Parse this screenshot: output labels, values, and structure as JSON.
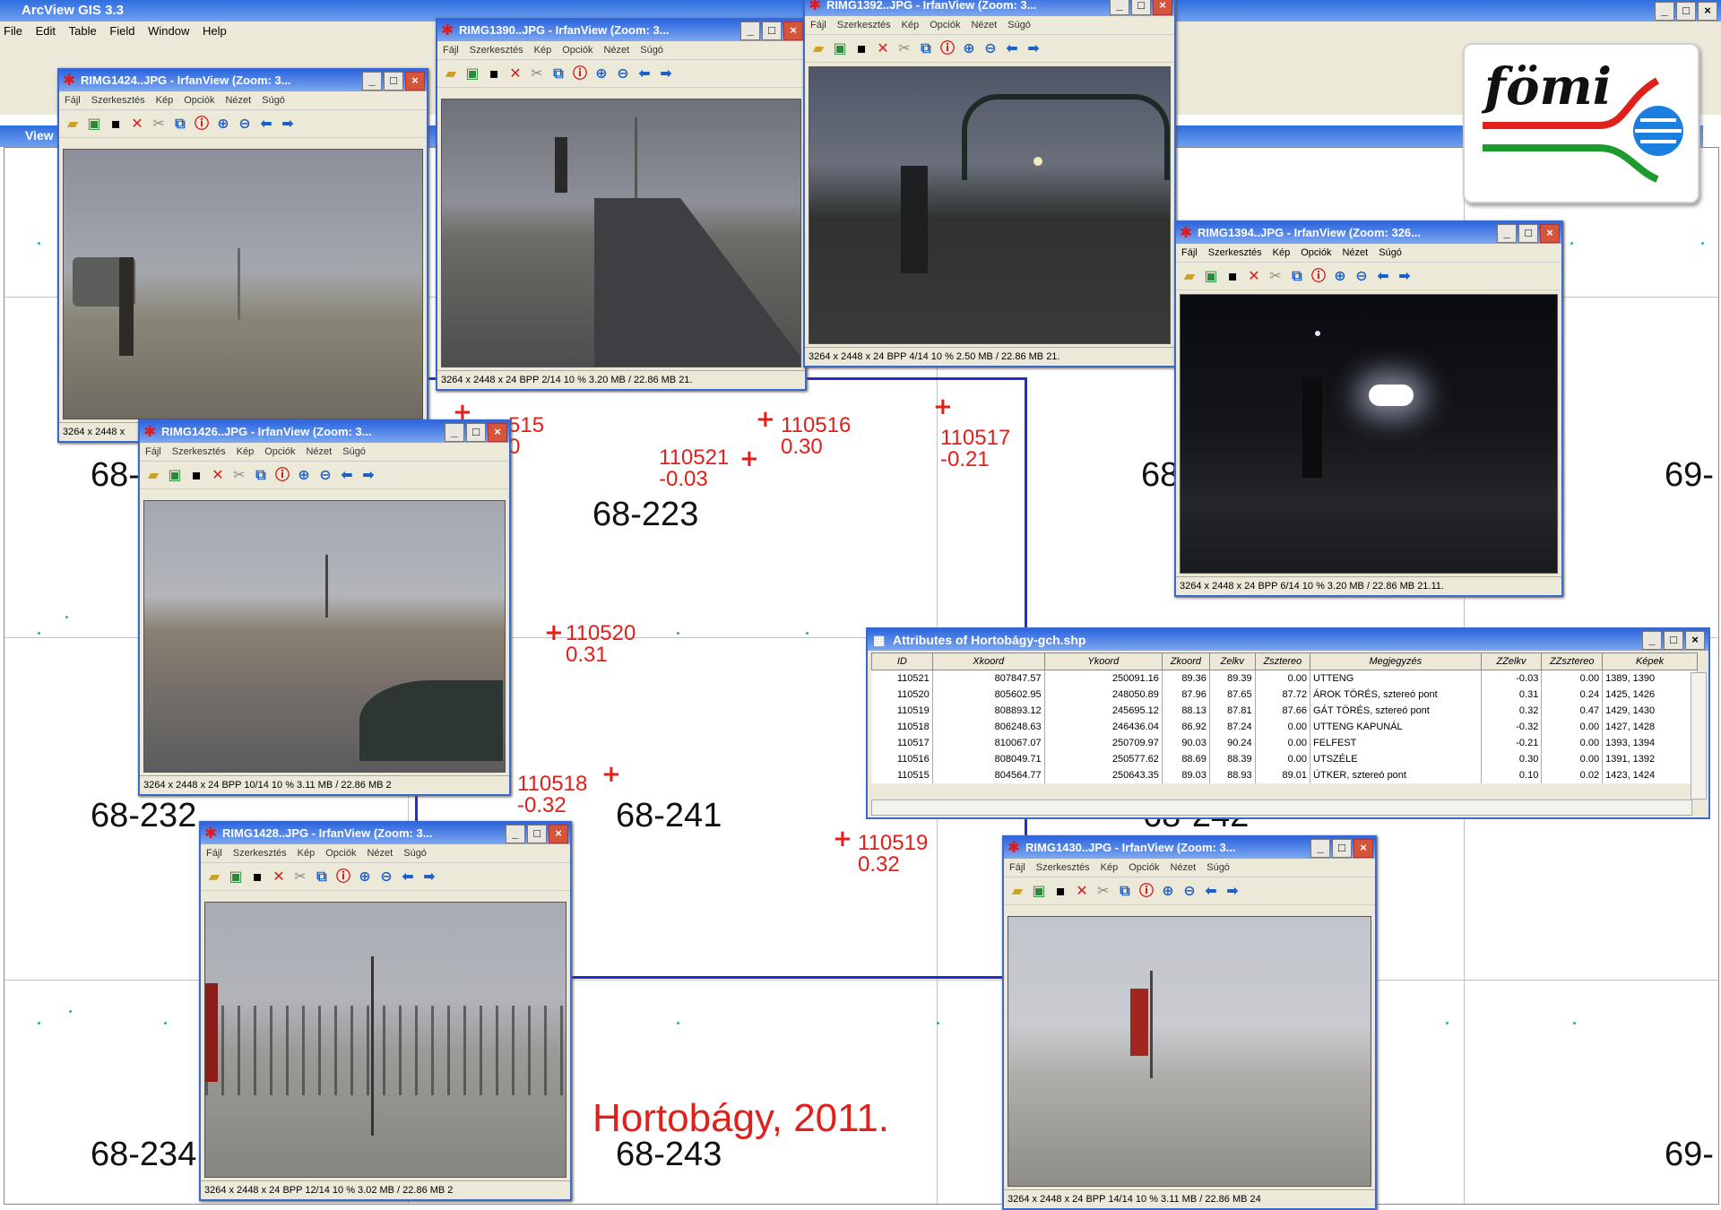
{
  "app": {
    "title": "ArcView GIS 3.3",
    "menu": [
      "File",
      "Edit",
      "Table",
      "Field",
      "Window",
      "Help"
    ],
    "view_title": "View"
  },
  "sheets": [
    {
      "id": "s1",
      "label": "68-"
    },
    {
      "id": "s2",
      "label": "68-223"
    },
    {
      "id": "s3",
      "label": "68"
    },
    {
      "id": "s4",
      "label": "69-"
    },
    {
      "id": "s5",
      "label": "68-232"
    },
    {
      "id": "s6",
      "label": "68-241"
    },
    {
      "id": "s7",
      "label": "68-242"
    },
    {
      "id": "s8",
      "label": "68-234"
    },
    {
      "id": "s9",
      "label": "68-243"
    },
    {
      "id": "s10",
      "label": "69-"
    }
  ],
  "points": [
    {
      "id": "110515",
      "label": "515",
      "value": "0"
    },
    {
      "id": "110516",
      "label": "110516",
      "value": "0.30"
    },
    {
      "id": "110517",
      "label": "110517",
      "value": "-0.21"
    },
    {
      "id": "110521",
      "label": "110521",
      "value": "-0.03"
    },
    {
      "id": "110520",
      "label": "110520",
      "value": "0.31"
    },
    {
      "id": "110518",
      "label": "110518",
      "value": "-0.32"
    },
    {
      "id": "110519",
      "label": "110519",
      "value": "0.32"
    }
  ],
  "caption": "Hortobágy, 2011.",
  "logo_text": "fömi",
  "irfan_windows": [
    {
      "title": "RIMG1424..JPG - IrfanView (Zoom: 3...",
      "status": "3264 x 2448 x"
    },
    {
      "title": "RIMG1390..JPG - IrfanView (Zoom: 3...",
      "status": "3264 x 2448 x 24 BPP    2/14    10 %   3.20 MB / 22.86 MB   21."
    },
    {
      "title": "RIMG1392..JPG - IrfanView (Zoom: 3...",
      "status": "3264 x 2448 x 24 BPP    4/14    10 %   2.50 MB / 22.86 MB   21."
    },
    {
      "title": "RIMG1394..JPG - IrfanView (Zoom: 326...",
      "status": "3264 x 2448 x 24 BPP    6/14    10 %   3.20 MB / 22.86 MB   21.11."
    },
    {
      "title": "RIMG1426..JPG - IrfanView (Zoom: 3...",
      "status": "3264 x 2448 x 24 BPP    10/14    10 %   3.11 MB / 22.86 MB   2"
    },
    {
      "title": "RIMG1428..JPG - IrfanView (Zoom: 3...",
      "status": "3264 x 2448 x 24 BPP    12/14    10 %   3.02 MB / 22.86 MB   2"
    },
    {
      "title": "RIMG1430..JPG - IrfanView (Zoom: 3...",
      "status": "3264 x 2448 x 24 BPP    14/14    10 %   3.11 MB / 22.86 MB   24"
    }
  ],
  "irfan_menu": [
    "Fájl",
    "Szerkesztés",
    "Kép",
    "Opciók",
    "Nézet",
    "Súgó"
  ],
  "attributes": {
    "title": "Attributes of Hortobágy-gch.shp",
    "columns": [
      "ID",
      "Xkoord",
      "Ykoord",
      "Zkoord",
      "Zelkv",
      "Zsztereo",
      "Megjegyzés",
      "ZZelkv",
      "ZZsztereo",
      "Képek"
    ],
    "rows": [
      [
        "110521",
        "807847.57",
        "250091.16",
        "89.36",
        "89.39",
        "0.00",
        "UTTENG",
        "-0.03",
        "0.00",
        "1389, 1390"
      ],
      [
        "110520",
        "805602.95",
        "248050.89",
        "87.96",
        "87.65",
        "87.72",
        "ÁROK TÖRÉS, sztereó pont",
        "0.31",
        "0.24",
        "1425, 1426"
      ],
      [
        "110519",
        "808893.12",
        "245695.12",
        "88.13",
        "87.81",
        "87.66",
        "GÁT TÖRÉS, sztereó pont",
        "0.32",
        "0.47",
        "1429, 1430"
      ],
      [
        "110518",
        "806248.63",
        "246436.04",
        "86.92",
        "87.24",
        "0.00",
        "UTTENG KAPUNÁL",
        "-0.32",
        "0.00",
        "1427, 1428"
      ],
      [
        "110517",
        "810067.07",
        "250709.97",
        "90.03",
        "90.24",
        "0.00",
        "FELFEST",
        "-0.21",
        "0.00",
        "1393, 1394"
      ],
      [
        "110516",
        "808049.71",
        "250577.62",
        "88.69",
        "88.39",
        "0.00",
        "UTSZÉLE",
        "0.30",
        "0.00",
        "1391, 1392"
      ],
      [
        "110515",
        "804564.77",
        "250643.35",
        "89.03",
        "88.93",
        "89.01",
        "ÚTKER, sztereó pont",
        "0.10",
        "0.02",
        "1423, 1424"
      ]
    ]
  }
}
